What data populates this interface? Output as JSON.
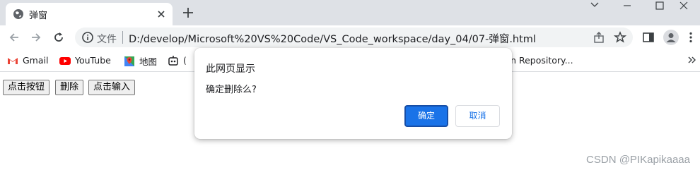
{
  "tab": {
    "title": "弹窗"
  },
  "omnibox": {
    "scheme_label": "文件",
    "url": "D:/develop/Microsoft%20VS%20Code/VS_Code_workspace/day_04/07-弹窗.html"
  },
  "bookmarks": [
    {
      "label": "Gmail",
      "icon": "gmail-icon"
    },
    {
      "label": "YouTube",
      "icon": "youtube-icon"
    },
    {
      "label": "地图",
      "icon": "maps-icon"
    },
    {
      "label": "(",
      "icon": "robot-icon"
    },
    {
      "label": "ven Repository...",
      "icon": ""
    }
  ],
  "page": {
    "buttons": [
      {
        "label": "点击按钮"
      },
      {
        "label": "删除"
      },
      {
        "label": "点击输入"
      }
    ]
  },
  "dialog": {
    "title": "此网页显示",
    "message": "确定删除么?",
    "ok_label": "确定",
    "cancel_label": "取消"
  },
  "watermark": "CSDN @PIKapikaaaa",
  "colors": {
    "accent": "#1a73e8",
    "tabstrip": "#dee1e6"
  }
}
